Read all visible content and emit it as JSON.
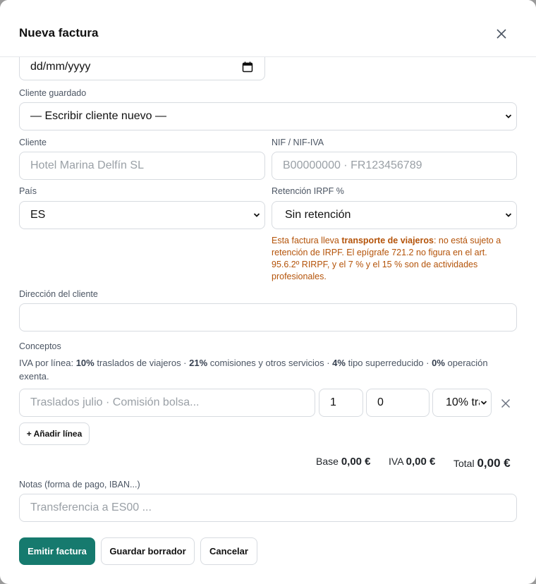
{
  "modal": {
    "title": "Nueva factura"
  },
  "form": {
    "date_placeholder": "dd/mm/yyyy",
    "saved_client_label": "Cliente guardado",
    "saved_client_value": "— Escribir cliente nuevo —",
    "client_label": "Cliente",
    "client_placeholder": "Hotel Marina Delfín SL",
    "nif_label": "NIF / NIF-IVA",
    "nif_placeholder": "B00000000 · FR123456789",
    "country_label": "País",
    "country_value": "ES",
    "irpf_label": "Retención IRPF %",
    "irpf_value": "Sin retención",
    "irpf_warning_before": "Esta factura lleva ",
    "irpf_warning_bold": "transporte de viajeros",
    "irpf_warning_after": ": no está sujeto a retención de IRPF. El epígrafe 721.2 no figura en el art. 95.6.2º RIRPF, y el 7 % y el 15 % son de actividades profesionales.",
    "address_label": "Dirección del cliente",
    "address_value": "",
    "concepts_label": "Conceptos",
    "iva_prefix": "IVA por línea: ",
    "iva_10": "10%",
    "iva_10_text": " traslados de viajeros · ",
    "iva_21": "21%",
    "iva_21_text": " comisiones y otros servicios · ",
    "iva_4": "4%",
    "iva_4_text": " tipo superreducido · ",
    "iva_0": "0%",
    "iva_0_text": " operación exenta.",
    "line": {
      "description_placeholder": "Traslados julio · Comisión bolsa...",
      "quantity": "1",
      "price": "0",
      "vat": "10% tra"
    },
    "add_line_label": "+ Añadir línea",
    "base_label": "Base",
    "base_value": "0,00 €",
    "iva_label": "IVA",
    "iva_value": "0,00 €",
    "total_label": "Total",
    "total_value": "0,00 €",
    "notes_label": "Notas (forma de pago, IBAN...)",
    "notes_placeholder": "Transferencia a ES00 ..."
  },
  "actions": {
    "issue_label": "Emitir factura",
    "draft_label": "Guardar borrador",
    "cancel_label": "Cancelar"
  },
  "colors": {
    "primary": "#167a6e",
    "warning": "#b45309"
  }
}
